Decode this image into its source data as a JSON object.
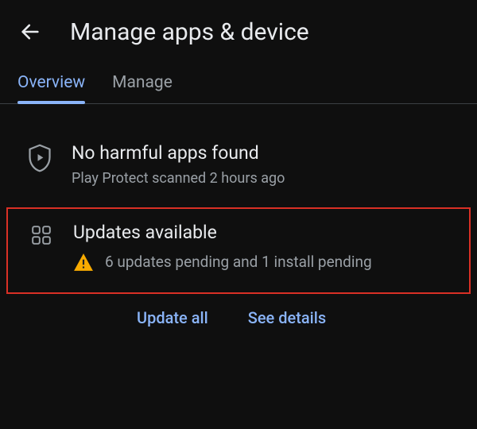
{
  "header": {
    "title": "Manage apps & device"
  },
  "tabs": {
    "overview": "Overview",
    "manage": "Manage"
  },
  "protect": {
    "title": "No harmful apps found",
    "subtitle": "Play Protect scanned 2 hours ago"
  },
  "updates": {
    "title": "Updates available",
    "subtitle": "6 updates pending and 1 install pending",
    "update_all": "Update all",
    "see_details": "See details"
  }
}
